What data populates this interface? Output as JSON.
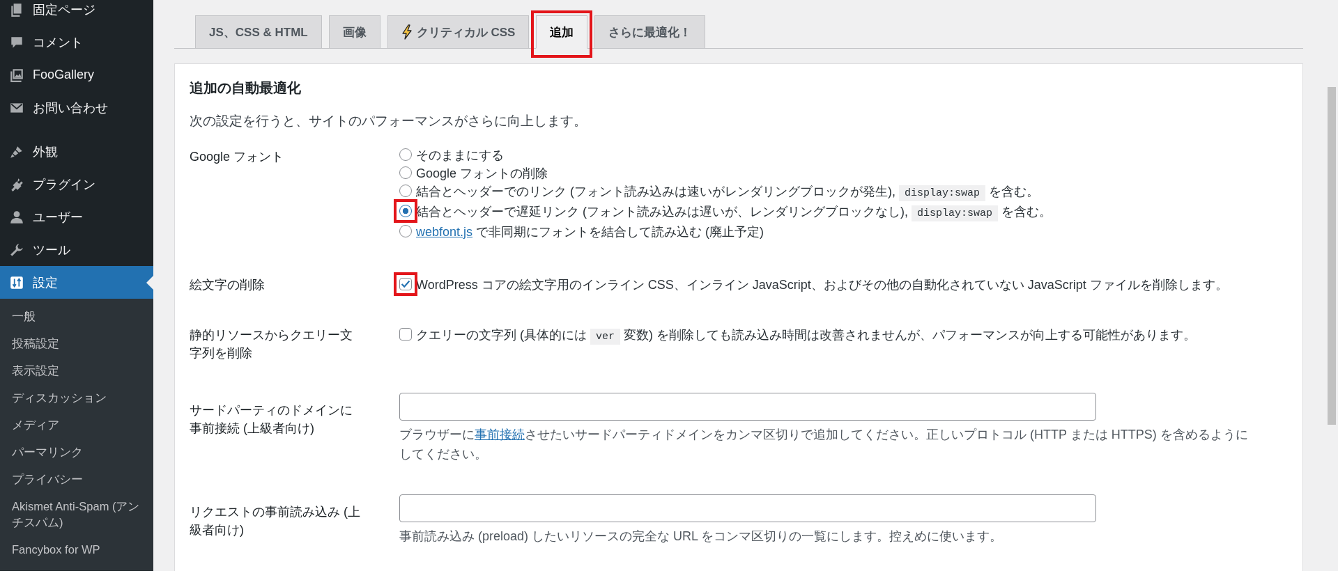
{
  "sidebar": {
    "groups": [
      {
        "items": [
          {
            "label": "固定ページ",
            "selected": false
          },
          {
            "label": "コメント",
            "selected": false
          },
          {
            "label": "FooGallery",
            "selected": false
          },
          {
            "label": "お問い合わせ",
            "selected": false
          }
        ]
      },
      {
        "items": [
          {
            "label": "外観",
            "selected": false
          },
          {
            "label": "プラグイン",
            "selected": false
          },
          {
            "label": "ユーザー",
            "selected": false
          },
          {
            "label": "ツール",
            "selected": false
          },
          {
            "label": "設定",
            "selected": true,
            "children": [
              {
                "label": "一般",
                "selected": false
              },
              {
                "label": "投稿設定",
                "selected": false
              },
              {
                "label": "表示設定",
                "selected": false
              },
              {
                "label": "ディスカッション",
                "selected": false
              },
              {
                "label": "メディア",
                "selected": false
              },
              {
                "label": "パーマリンク",
                "selected": false
              },
              {
                "label": "プライバシー",
                "selected": false
              },
              {
                "label": "Akismet Anti-Spam (アンチスパム)",
                "selected": false
              },
              {
                "label": "Fancybox for WP",
                "selected": false
              }
            ]
          }
        ]
      }
    ]
  },
  "tabs": [
    {
      "label": "JS、CSS & HTML",
      "kind": "plain",
      "selected": false,
      "highlighted": false
    },
    {
      "label": "画像",
      "kind": "plain",
      "selected": false,
      "highlighted": false
    },
    {
      "label": "クリティカル CSS",
      "kind": "icon",
      "selected": false,
      "highlighted": false
    },
    {
      "label": "追加",
      "kind": "plain",
      "selected": true,
      "highlighted": true
    },
    {
      "label": "さらに最適化！",
      "kind": "plain",
      "selected": false,
      "highlighted": false
    }
  ],
  "section": {
    "title": "追加の自動最適化",
    "description": "次の設定を行うと、サイトのパフォーマンスがさらに向上します。",
    "rows": [
      {
        "kind": "radio",
        "label": "Google フォント",
        "options": [
          {
            "selected": false,
            "highlighted": false,
            "parts": [
              {
                "text": "そのままにする"
              }
            ]
          },
          {
            "selected": false,
            "highlighted": false,
            "parts": [
              {
                "text": "Google フォントの削除"
              }
            ]
          },
          {
            "selected": false,
            "highlighted": false,
            "parts": [
              {
                "text": "結合とヘッダーでのリンク (フォント読み込みは速いがレンダリングブロックが発生), "
              },
              {
                "code": "display:swap"
              },
              {
                "text": " を含む。"
              }
            ]
          },
          {
            "selected": true,
            "highlighted": true,
            "parts": [
              {
                "text": "結合とヘッダーで遅延リンク (フォント読み込みは遅いが、レンダリングブロックなし), "
              },
              {
                "code": "display:swap"
              },
              {
                "text": " を含む。"
              }
            ]
          },
          {
            "selected": false,
            "highlighted": false,
            "parts": [
              {
                "link": "webfont.js"
              },
              {
                "text": " で非同期にフォントを結合して読み込む (廃止予定)"
              }
            ]
          }
        ]
      },
      {
        "kind": "checkbox",
        "label": "絵文字の削除",
        "checked": true,
        "highlighted": true,
        "parts": [
          {
            "text": "WordPress コアの絵文字用のインライン CSS、インライン JavaScript、およびその他の自動化されていない JavaScript ファイルを削除します。"
          }
        ]
      },
      {
        "kind": "checkbox",
        "label": "静的リソースからクエリー文字列を削除",
        "checked": false,
        "highlighted": false,
        "parts": [
          {
            "text": "クエリーの文字列 (具体的には "
          },
          {
            "code": "ver"
          },
          {
            "text": " 変数) を削除しても読み込み時間は改善されませんが、パフォーマンスが向上する可能性があります。"
          }
        ]
      },
      {
        "kind": "text",
        "label": "サードパーティのドメインに事前接続 (上級者向け)",
        "help": [
          {
            "text": "ブラウザーに"
          },
          {
            "link": "事前接続"
          },
          {
            "text": "させたいサードパーティドメインをカンマ区切りで追加してください。正しいプロトコル (HTTP または HTTPS) を含めるようにしてください。"
          }
        ]
      },
      {
        "kind": "text",
        "label": "リクエストの事前読み込み (上級者向け)",
        "help": [
          {
            "text": "事前読み込み (preload) したいリソースの完全な URL をコンマ区切りの一覧にします。控えめに使います。"
          }
        ]
      }
    ]
  }
}
